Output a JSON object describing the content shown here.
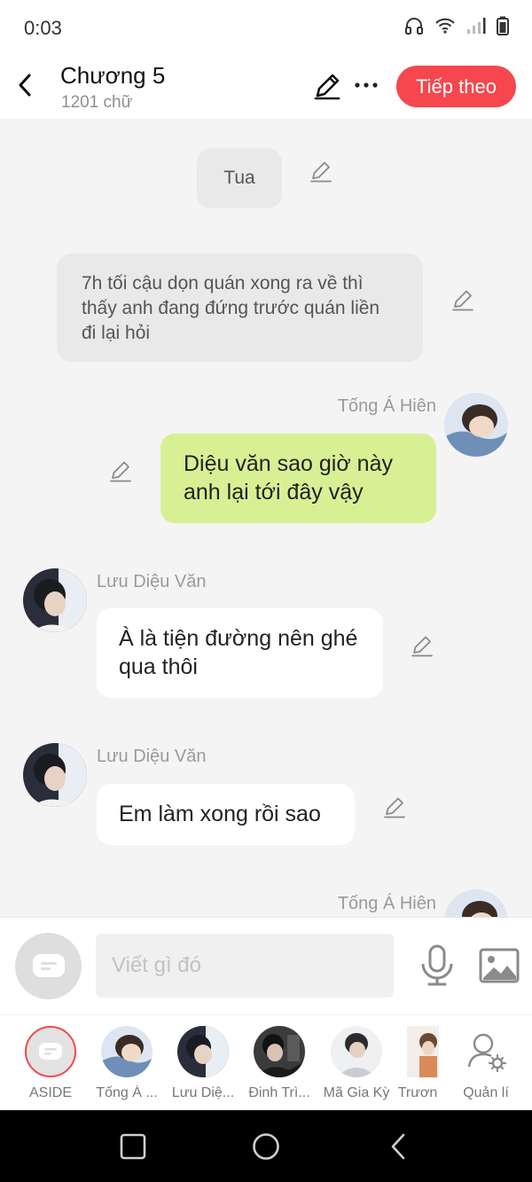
{
  "status_bar": {
    "time": "0:03"
  },
  "header": {
    "title": "Chương 5",
    "word_count": "1201 chữ",
    "next_label": "Tiếp theo"
  },
  "messages": {
    "narration_1": "Tua",
    "narration_2": "7h tối cậu dọn quán xong ra về thì thấy anh đang đứng trước quán liền đi lại hỏi",
    "msg_1": {
      "sender": "Tống Á Hiên",
      "text": "Diệu văn sao giờ này anh lại tới đây vậy"
    },
    "msg_2": {
      "sender": "Lưu Diệu Văn",
      "text": "À là tiện đường nên ghé qua thôi"
    },
    "msg_3": {
      "sender": "Lưu Diệu Văn",
      "text": "Em làm xong rồi sao"
    },
    "msg_4": {
      "sender": "Tống Á Hiên"
    }
  },
  "composer": {
    "placeholder": "Viết gì đó"
  },
  "characters": [
    {
      "label": "ASIDE"
    },
    {
      "label": "Tống Á ..."
    },
    {
      "label": "Lưu Diệ..."
    },
    {
      "label": "Đinh Trì..."
    },
    {
      "label": "Mã Gia Kỳ"
    },
    {
      "label": "Trươn"
    },
    {
      "label": "Quản lí"
    }
  ],
  "colors": {
    "accent": "#f5474d",
    "outgoing_bubble": "#d8f094",
    "incoming_bubble": "#ffffff",
    "narration_bubble": "#e9e9e9"
  }
}
